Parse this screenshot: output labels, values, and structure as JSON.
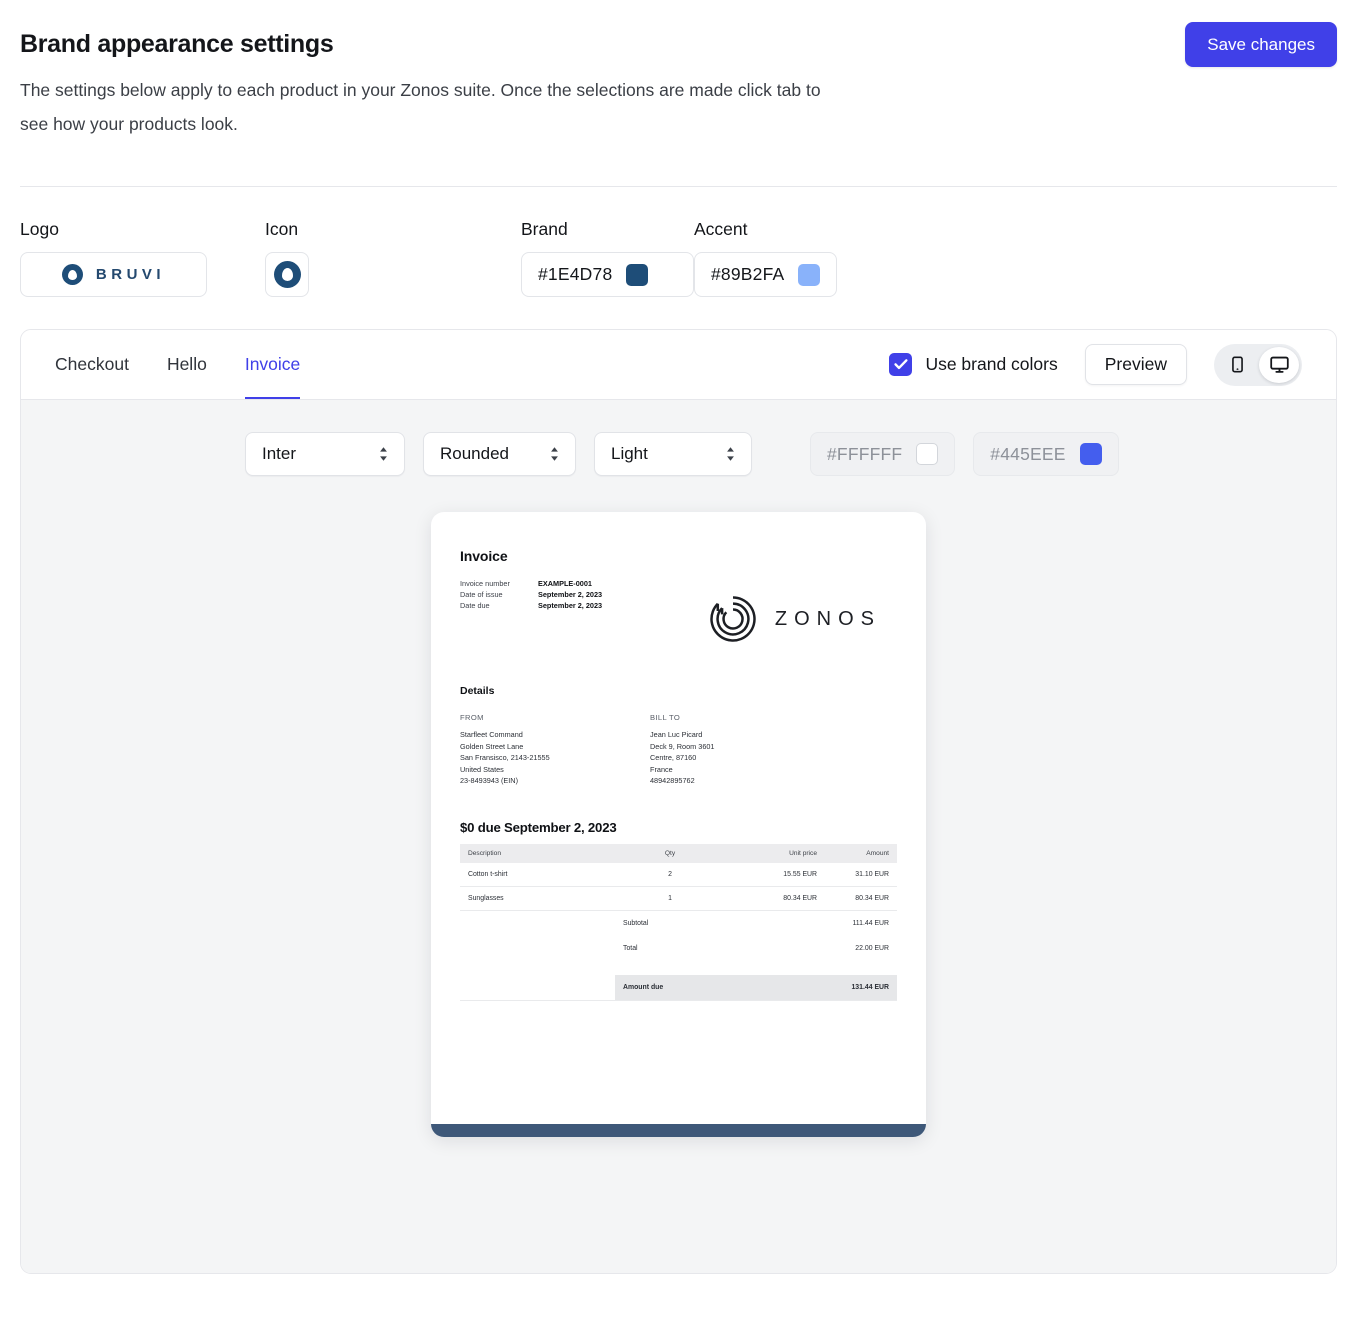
{
  "header": {
    "title": "Brand appearance settings",
    "subtitle": "The settings below apply to each product in your Zonos suite. Once the selections are made click tab to see how your products look.",
    "save_label": "Save changes",
    "save_color": "#4040E8"
  },
  "fields": {
    "logo": {
      "label": "Logo",
      "wordmark": "BRUVI"
    },
    "icon": {
      "label": "Icon"
    },
    "brand": {
      "label": "Brand",
      "value": "#1E4D78",
      "color": "#1E4D78"
    },
    "accent": {
      "label": "Accent",
      "value": "#89B2FA",
      "color": "#89B2FA"
    }
  },
  "panel": {
    "tabs": [
      {
        "label": "Checkout",
        "active": false
      },
      {
        "label": "Hello",
        "active": false
      },
      {
        "label": "Invoice",
        "active": true
      }
    ],
    "use_brand_colors": {
      "label": "Use brand colors",
      "checked": true
    },
    "preview_label": "Preview",
    "devices": [
      {
        "name": "mobile",
        "active": false
      },
      {
        "name": "desktop",
        "active": true
      }
    ],
    "controls": {
      "font": {
        "value": "Inter"
      },
      "corners": {
        "value": "Rounded"
      },
      "theme": {
        "value": "Light"
      },
      "background": {
        "value": "#FFFFFF",
        "color": "#FFFFFF",
        "disabled": true
      },
      "foreground": {
        "value": "#445EEE",
        "color": "#445EEE",
        "disabled": true
      }
    }
  },
  "invoice": {
    "title": "Invoice",
    "meta": [
      {
        "key": "Invoice number",
        "value": "EXAMPLE-0001"
      },
      {
        "key": "Date of issue",
        "value": "September 2, 2023"
      },
      {
        "key": "Date due",
        "value": "September 2, 2023"
      }
    ],
    "brandmark_word": "ZONOS",
    "details_heading": "Details",
    "from": {
      "heading": "FROM",
      "lines": [
        "Starfleet Command",
        "Golden Street Lane",
        "San Fransisco, 2143-21555",
        "United States",
        "23-8493943 (EIN)"
      ]
    },
    "bill_to": {
      "heading": "BILL TO",
      "lines": [
        "Jean Luc Picard",
        "Deck 9, Room 3601",
        "Centre, 87160",
        "France",
        "48942895762"
      ]
    },
    "due_heading": "$0 due September 2, 2023",
    "table": {
      "columns": [
        "Description",
        "Qty",
        "Unit price",
        "Amount"
      ],
      "rows": [
        {
          "description": "Cotton t-shirt",
          "qty": "2",
          "unit_price": "15.55 EUR",
          "amount": "31.10 EUR"
        },
        {
          "description": "Sunglasses",
          "qty": "1",
          "unit_price": "80.34 EUR",
          "amount": "80.34 EUR"
        }
      ],
      "totals": [
        {
          "label": "Subtotal",
          "value": "111.44 EUR"
        },
        {
          "label": "Total",
          "value": "22.00 EUR"
        }
      ],
      "amount_due": {
        "label": "Amount due",
        "value": "131.44 EUR"
      }
    },
    "footer_color": "#3E5879"
  }
}
